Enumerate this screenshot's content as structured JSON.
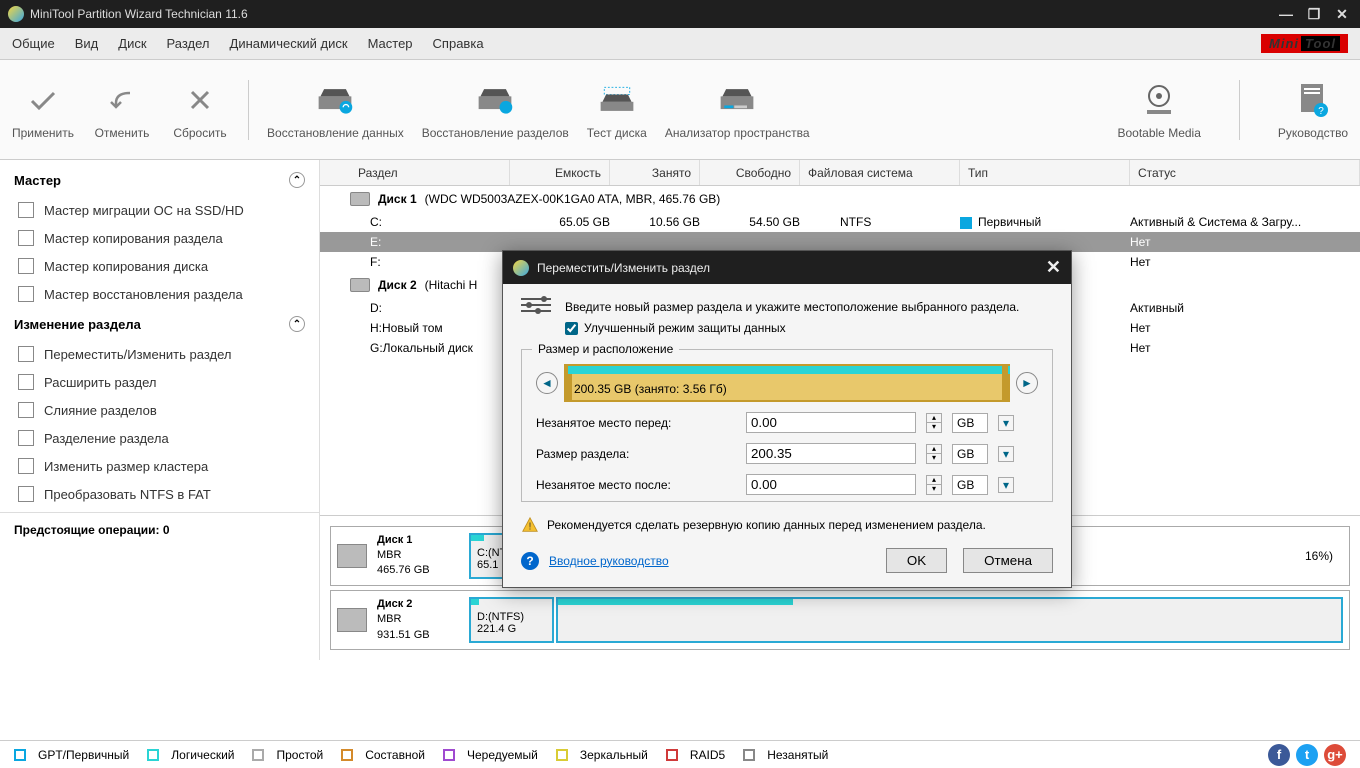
{
  "app": {
    "title": "MiniTool Partition Wizard Technician 11.6"
  },
  "menu": [
    "Общие",
    "Вид",
    "Диск",
    "Раздел",
    "Динамический диск",
    "Мастер",
    "Справка"
  ],
  "logo": {
    "a": "Mini",
    "b": "Tool"
  },
  "toolbar": {
    "apply": "Применить",
    "undo": "Отменить",
    "discard": "Сбросить",
    "datarec": "Восстановление данных",
    "partrec": "Восстановление разделов",
    "disktest": "Тест диска",
    "space": "Анализатор пространства",
    "bootable": "Bootable Media",
    "guide": "Руководство"
  },
  "sidebar": {
    "groups": [
      {
        "title": "Мастер",
        "items": [
          "Мастер миграции ОС на SSD/HD",
          "Мастер копирования раздела",
          "Мастер копирования диска",
          "Мастер восстановления раздела"
        ]
      },
      {
        "title": "Изменение раздела",
        "items": [
          "Переместить/Изменить раздел",
          "Расширить раздел",
          "Слияние разделов",
          "Разделение раздела",
          "Изменить размер кластера",
          "Преобразовать NTFS в FAT"
        ]
      }
    ],
    "pending": "Предстоящие операции: 0"
  },
  "columns": [
    "Раздел",
    "Емкость",
    "Занято",
    "Свободно",
    "Файловая система",
    "Тип",
    "Статус"
  ],
  "disks": [
    {
      "name": "Диск 1",
      "desc": "(WDC WD5003AZEX-00K1GA0 ATA, MBR, 465.76 GB)",
      "parts": [
        {
          "letter": "C:",
          "cap": "65.05 GB",
          "used": "10.56 GB",
          "free": "54.50 GB",
          "fs": "NTFS",
          "type": "Первичный",
          "tc": "#0aa7e0",
          "status": "Активный & Система & Загру..."
        },
        {
          "letter": "E:",
          "cap": "",
          "used": "",
          "free": "",
          "fs": "",
          "type": "",
          "tc": "",
          "status": "Нет",
          "selected": true
        },
        {
          "letter": "F:",
          "cap": "",
          "used": "",
          "free": "",
          "fs": "",
          "type": "",
          "tc": "",
          "status": "Нет"
        }
      ]
    },
    {
      "name": "Диск 2",
      "desc": "(Hitachi H",
      "parts": [
        {
          "letter": "D:",
          "cap": "",
          "used": "",
          "free": "",
          "fs": "",
          "type": "",
          "tc": "",
          "status": "Активный"
        },
        {
          "letter": "H:Новый том",
          "cap": "",
          "used": "",
          "free": "",
          "fs": "",
          "type": "",
          "tc": "",
          "status": "Нет"
        },
        {
          "letter": "G:Локальный диск",
          "cap": "",
          "used": "",
          "free": "",
          "fs": "",
          "type": "",
          "tc": "",
          "status": "Нет"
        }
      ]
    }
  ],
  "diskmaps": [
    {
      "name": "Диск 1",
      "scheme": "MBR",
      "size": "465.76 GB",
      "bars": [
        {
          "label": "C:(NTFS)",
          "sub": "65.1 GB",
          "w": 85,
          "fill": 16
        }
      ],
      "extra": "16%)"
    },
    {
      "name": "Диск 2",
      "scheme": "MBR",
      "size": "931.51 GB",
      "bars": [
        {
          "label": "D:(NTFS)",
          "sub": "221.4 G",
          "w": 85,
          "fill": 10
        }
      ]
    }
  ],
  "legend": [
    {
      "c": "#0aa7e0",
      "t": "GPT/Первичный"
    },
    {
      "c": "#2ad4d4",
      "t": "Логический"
    },
    {
      "c": "#aaa",
      "t": "Простой"
    },
    {
      "c": "#d48a2a",
      "t": "Составной"
    },
    {
      "c": "#a04ad0",
      "t": "Чередуемый"
    },
    {
      "c": "#d9cc35",
      "t": "Зеркальный"
    },
    {
      "c": "#d03a3a",
      "t": "RAID5"
    },
    {
      "c": "#888",
      "t": "Незанятый"
    }
  ],
  "dialog": {
    "title": "Переместить/Изменить раздел",
    "intro": "Введите новый размер раздела и укажите местоположение выбранного раздела.",
    "checkbox": "Улучшенный режим защиты данных",
    "fieldset": "Размер и расположение",
    "barlabel": "200.35 GB (занято: 3.56 Гб)",
    "rows": [
      {
        "label": "Незанятое место перед:",
        "value": "0.00",
        "unit": "GB"
      },
      {
        "label": "Размер раздела:",
        "value": "200.35",
        "unit": "GB"
      },
      {
        "label": "Незанятое место после:",
        "value": "0.00",
        "unit": "GB"
      }
    ],
    "warning": "Рекомендуется сделать резервную копию данных перед изменением раздела.",
    "help": "Вводное руководство",
    "ok": "OK",
    "cancel": "Отмена"
  }
}
